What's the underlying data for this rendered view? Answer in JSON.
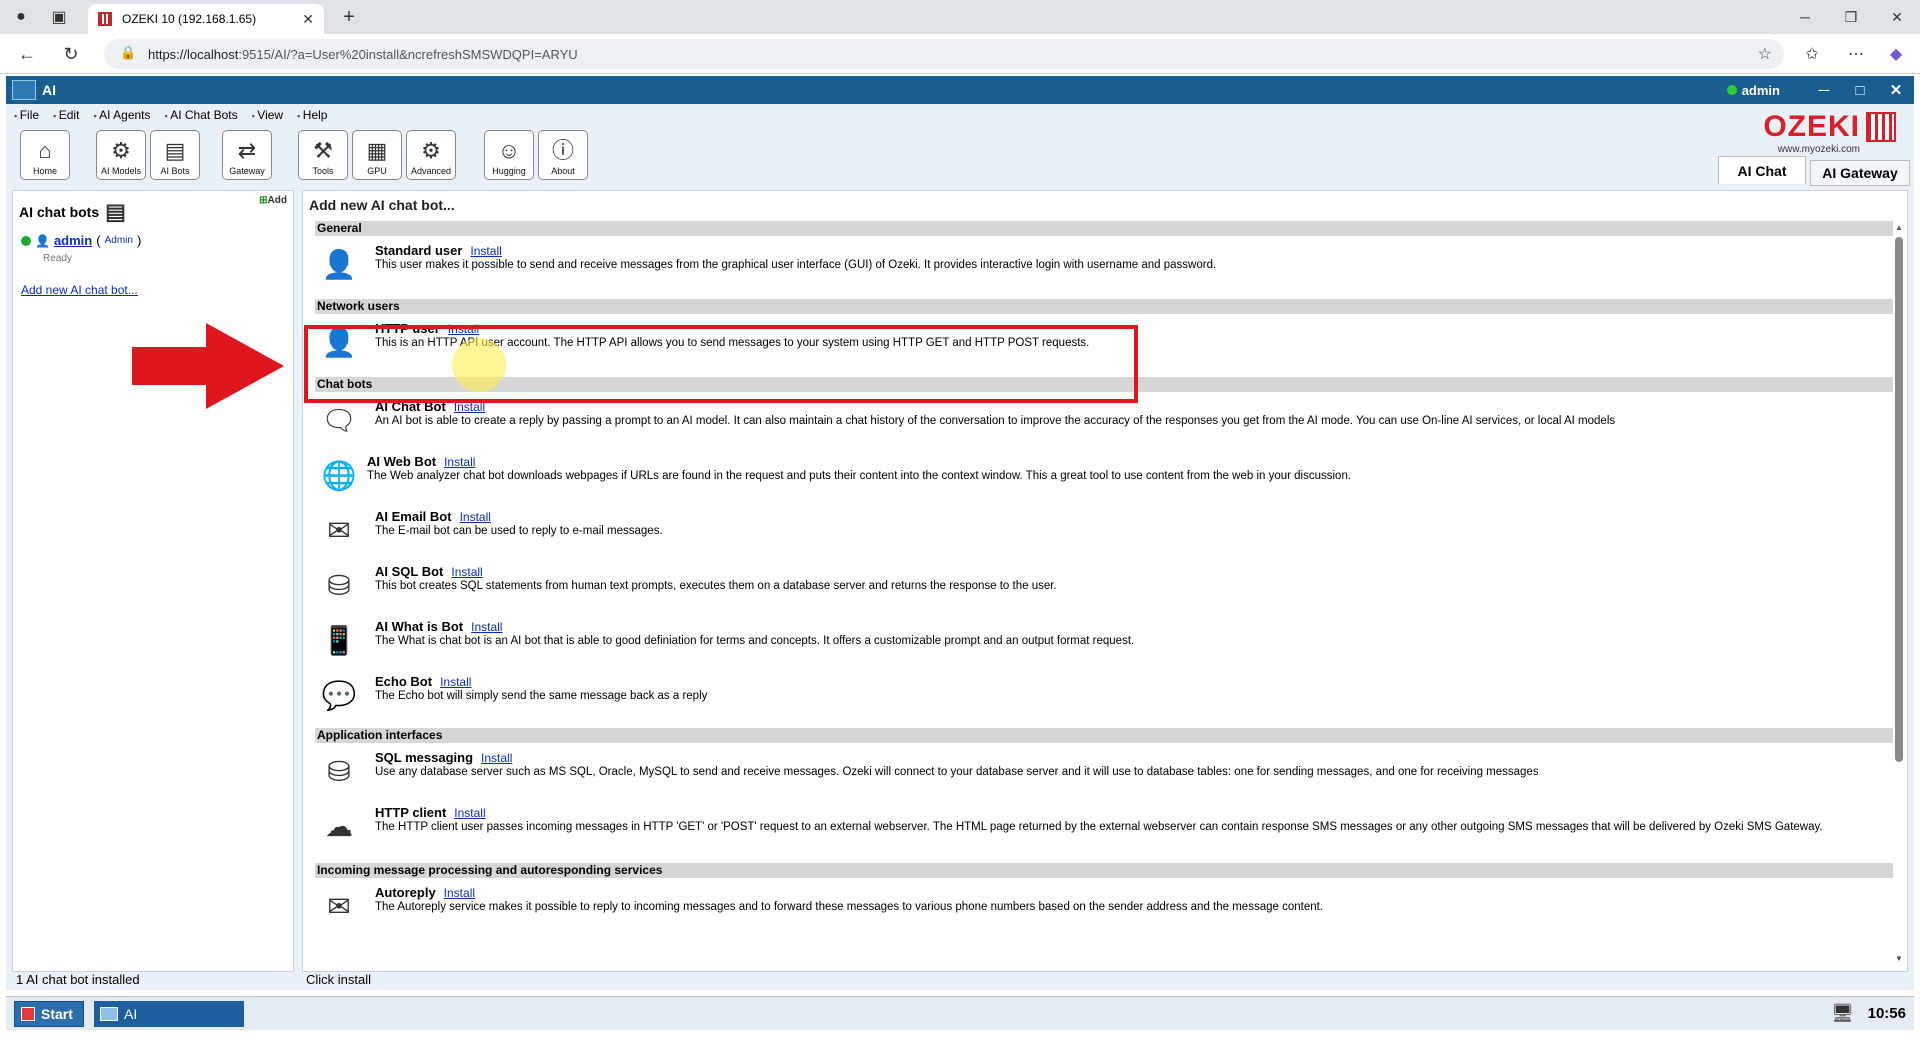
{
  "browser": {
    "tab_title": "OZEKI 10 (192.168.1.65)",
    "url_host": "https://localhost",
    "url_rest": ":9515/AI/?a=User%20install&ncrefreshSMSWDQPI=ARYU"
  },
  "app": {
    "title": "AI",
    "username": "admin"
  },
  "menu": [
    "File",
    "Edit",
    "AI Agents",
    "AI Chat Bots",
    "View",
    "Help"
  ],
  "toolbar": [
    {
      "label": "Home",
      "icon": "home-icon"
    },
    {
      "label": "AI Models",
      "icon": "ai-models-icon"
    },
    {
      "label": "AI Bots",
      "icon": "ai-bots-icon"
    },
    {
      "label": "Gateway",
      "icon": "gateway-icon"
    },
    {
      "label": "Tools",
      "icon": "tools-icon"
    },
    {
      "label": "GPU",
      "icon": "gpu-icon"
    },
    {
      "label": "Advanced",
      "icon": "gear-icon"
    },
    {
      "label": "Hugging",
      "icon": "hugging-icon"
    },
    {
      "label": "About",
      "icon": "info-icon"
    }
  ],
  "logo": {
    "brand": "OZEKI",
    "site": "www.myozeki.com"
  },
  "tabs": {
    "ai_chat": "AI Chat",
    "ai_gateway": "AI Gateway"
  },
  "left_panel": {
    "title": "AI chat bots",
    "add_label": "Add",
    "bot_name": "admin",
    "bot_role": "Admin",
    "bot_status": "Ready",
    "add_link": "Add new AI chat bot...",
    "status": "1 AI chat bot installed"
  },
  "main_panel": {
    "title": "Add new AI chat bot...",
    "install_label": "Install",
    "status": "Click install",
    "sections": [
      {
        "title": "General",
        "items": [
          {
            "name": "Standard user",
            "icon": "user-icon",
            "desc": "This user makes it possible to send and receive messages from the graphical user interface (GUI) of Ozeki. It provides interactive login with username and password."
          }
        ]
      },
      {
        "title": "Network users",
        "items": [
          {
            "name": "HTTP user",
            "icon": "http-user-icon",
            "desc": "This is an HTTP API user account. The HTTP API allows you to send messages to your system using HTTP GET and HTTP POST requests."
          }
        ]
      },
      {
        "title": "Chat bots",
        "items": [
          {
            "name": "AI Chat Bot",
            "icon": "chat-bot-icon",
            "desc": "An AI bot is able to create a reply by passing a prompt to an AI model. It can also maintain a chat history of the conversation to improve the accuracy of the responses you get from the AI mode. You can use On-line AI services, or local AI models"
          },
          {
            "name": "AI Web Bot",
            "icon": "globe-icon",
            "desc": "The Web analyzer chat bot downloads webpages if URLs are found in the request and puts their content into the context window. This a great tool to use content from the web in your discussion."
          },
          {
            "name": "AI Email Bot",
            "icon": "email-icon",
            "desc": "The E-mail bot can be used to reply to e-mail messages."
          },
          {
            "name": "AI SQL Bot",
            "icon": "database-icon",
            "desc": "This bot creates SQL statements from human text prompts, executes them on a database server and returns the response to the user."
          },
          {
            "name": "AI What is Bot",
            "icon": "question-bot-icon",
            "desc": "The What is chat bot is an AI bot that is able to good definiation for terms and concepts. It offers a customizable prompt and an output format request."
          },
          {
            "name": "Echo Bot",
            "icon": "echo-icon",
            "desc": "The Echo bot will simply send the same message back as a reply"
          }
        ]
      },
      {
        "title": "Application interfaces",
        "items": [
          {
            "name": "SQL messaging",
            "icon": "sql-messaging-icon",
            "desc": "Use any database server such as MS SQL, Oracle, MySQL to send and receive messages. Ozeki will connect to your database server and it will use to database tables: one for sending messages, and one for receiving messages"
          },
          {
            "name": "HTTP client",
            "icon": "cloud-icon",
            "desc": "The HTTP client user passes incoming messages in HTTP 'GET' or 'POST' request to an external webserver. The HTML page returned by the external webserver can contain response SMS messages or any other outgoing SMS messages that will be delivered by Ozeki SMS Gateway."
          }
        ]
      },
      {
        "title": "Incoming message processing and autoresponding services",
        "items": [
          {
            "name": "Autoreply",
            "icon": "autoreply-icon",
            "desc": "The Autoreply service makes it possible to reply to incoming messages and to forward these messages to various phone numbers based on the sender address and the message content."
          }
        ]
      }
    ]
  },
  "taskbar": {
    "start": "Start",
    "app": "AI",
    "clock": "10:56"
  },
  "colors": {
    "titlebar": "#1a5d8f",
    "highlight": "#e0161e",
    "link": "#0a2fb5",
    "brand": "#d6202a"
  }
}
